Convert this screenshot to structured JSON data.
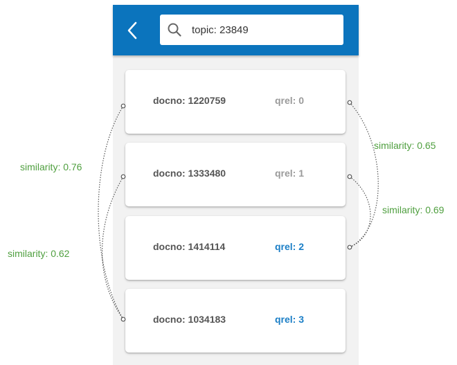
{
  "header": {
    "back_icon": "chevron-left-icon",
    "search_icon": "search-icon",
    "search_value": "topic: 23849",
    "color": "#0b74bd"
  },
  "documents": [
    {
      "docno": "docno: 1220759",
      "qrel": "qrel: 0",
      "qrel_color": "#9a9a9a"
    },
    {
      "docno": "docno: 1333480",
      "qrel": "qrel: 1",
      "qrel_color": "#9a9a9a"
    },
    {
      "docno": "docno: 1414114",
      "qrel": "qrel: 2",
      "qrel_color": "#1a7ec6"
    },
    {
      "docno": "docno: 1034183",
      "qrel": "qrel: 3",
      "qrel_color": "#1a7ec6"
    }
  ],
  "links": [
    {
      "from": 0,
      "to": 3,
      "side": "left",
      "label": "similarity: 0.76"
    },
    {
      "from": 1,
      "to": 3,
      "side": "left",
      "label": "similarity: 0.62"
    },
    {
      "from": 0,
      "to": 2,
      "side": "right",
      "label": "similarity: 0.65"
    },
    {
      "from": 1,
      "to": 2,
      "side": "right",
      "label": "similarity: 0.69"
    }
  ],
  "colors": {
    "similarity_label": "#4f9f3f",
    "link_line": "#555555"
  }
}
